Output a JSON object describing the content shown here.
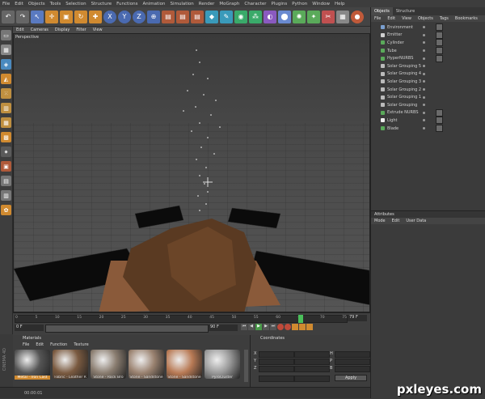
{
  "menu": [
    "File",
    "Edit",
    "Objects",
    "Tools",
    "Selection",
    "Structure",
    "Functions",
    "Animation",
    "Simulation",
    "Render",
    "MoGraph",
    "Character",
    "Plugins",
    "Python",
    "Window",
    "Help"
  ],
  "viewport": {
    "menu": [
      "Edit",
      "Cameras",
      "Display",
      "Filter",
      "View"
    ],
    "label": "Perspective"
  },
  "timeline": {
    "ticks": [
      "0",
      "5",
      "10",
      "15",
      "20",
      "25",
      "30",
      "35",
      "40",
      "45",
      "50",
      "55",
      "60",
      "65",
      "70",
      "75"
    ],
    "current_frame": "79",
    "end_frame": "79 F",
    "start_field": "0 F",
    "end_field": "90 F"
  },
  "materials": {
    "title": "Materials",
    "menu": [
      "File",
      "Edit",
      "Function",
      "Texture"
    ],
    "items": [
      {
        "label": "Metal - Iron Cast",
        "color": "#555"
      },
      {
        "label": "Fabric - Leather R",
        "color": "#7a5a40"
      },
      {
        "label": "Stone - Rock Bro",
        "color": "#8a7d70"
      },
      {
        "label": "Stone - Sandstone",
        "color": "#9a8270"
      },
      {
        "label": "Stone - Sandstone",
        "color": "#b87a55"
      },
      {
        "label": "PyroCluster",
        "color": "#999"
      }
    ]
  },
  "coordinates": {
    "title": "Coordinates",
    "labels": [
      "X",
      "Y",
      "Z"
    ],
    "right_labels": [
      "H",
      "P",
      "B"
    ],
    "apply": "Apply"
  },
  "status": {
    "time": "00:00:01"
  },
  "objects_panel": {
    "tabs": [
      "Objects",
      "Structure"
    ],
    "menu": [
      "File",
      "Edit",
      "View",
      "Objects",
      "Tags",
      "Bookmarks"
    ],
    "items": [
      {
        "name": "Environment",
        "icon": "#7aa0d0"
      },
      {
        "name": "Emitter",
        "icon": "#d0d0d0"
      },
      {
        "name": "Cylinder",
        "icon": "#5aaa5a"
      },
      {
        "name": "Tube",
        "icon": "#5aaa5a"
      },
      {
        "name": "HyperNURBS",
        "icon": "#5aaa5a"
      },
      {
        "name": "Solar Grouping 5",
        "icon": "#bbbbbb"
      },
      {
        "name": "Solar Grouping 4",
        "icon": "#bbbbbb"
      },
      {
        "name": "Solar Grouping 3",
        "icon": "#bbbbbb"
      },
      {
        "name": "Solar Grouping 2",
        "icon": "#bbbbbb"
      },
      {
        "name": "Solar Grouping 1",
        "icon": "#bbbbbb"
      },
      {
        "name": "Solar Grouping",
        "icon": "#bbbbbb"
      },
      {
        "name": "Extrude NURBS",
        "icon": "#5aaa5a"
      },
      {
        "name": "Light",
        "icon": "#eeeeee"
      },
      {
        "name": "Blade",
        "icon": "#5aaa5a"
      }
    ]
  },
  "attributes": {
    "title": "Attributes",
    "menu": [
      "Mode",
      "Edit",
      "User Data"
    ]
  },
  "watermark": "pxleyes.com",
  "brand_vertical": "CINEMA 4D"
}
